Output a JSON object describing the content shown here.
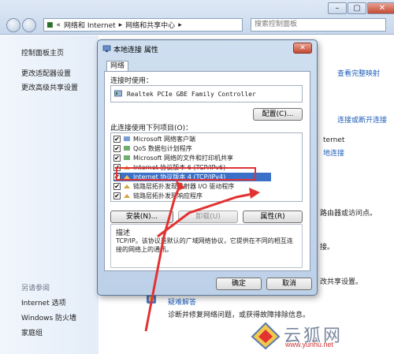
{
  "address_bar": {
    "path": [
      "«",
      "网络和 Internet",
      "▸",
      "网络和共享中心",
      "▸"
    ],
    "search_placeholder": "搜索控制面板"
  },
  "left_nav": {
    "items": [
      "控制面板主页",
      "更改适配器设置",
      "更改高级共享设置"
    ],
    "see_also_title": "另请参阅",
    "see_also_items": [
      "Internet 选项",
      "Windows 防火墙",
      "家庭组"
    ]
  },
  "right_content": {
    "view_full_map": "查看完整映射",
    "connect_disconnect": "连接或断开连接",
    "internet": "ternet",
    "local_connection": "地连接",
    "router_text": "路由器或访问点。",
    "connect_text": "接。",
    "sharing_text": "改共享设置。",
    "troubleshoot": "疑难解答",
    "troubleshoot_desc": "诊断并修复网络问题，或获得故障排除信息。"
  },
  "dialog": {
    "title": "本地连接 属性",
    "close_label": "✕",
    "tab_network": "网络",
    "connect_using_label": "连接时使用：",
    "adapter_name": "Realtek PCIe GBE Family Controller",
    "configure_button": "配置(C)...",
    "items_label": "此连接使用下列项目(O)：",
    "items": [
      {
        "label": "Microsoft 网络客户端",
        "checked": true
      },
      {
        "label": "QoS 数据包计划程序",
        "checked": true
      },
      {
        "label": "Microsoft 网络的文件和打印机共享",
        "checked": true
      },
      {
        "label": "Internet 协议版本 6 (TCP/IPv6)",
        "checked": true
      },
      {
        "label": "Internet 协议版本 4 (TCP/IPv4)",
        "checked": true
      },
      {
        "label": "链路层拓扑发现映射器 I/O 驱动程序",
        "checked": true
      },
      {
        "label": "链路层拓扑发现响应程序",
        "checked": true
      }
    ],
    "install_button": "安装(N)...",
    "uninstall_button": "卸载(U)",
    "properties_button": "属性(R)",
    "description_title": "描述",
    "description_text": "TCP/IP。该协议是默认的广域网络协议，它提供在不同的相互连接的网络上的通讯。",
    "ok_button": "确定",
    "cancel_button": "取消"
  },
  "watermark": {
    "text": "云狐网",
    "url": "www.yunhu.net"
  },
  "colors": {
    "selection": "#3a70c8",
    "highlight_box": "#e23232",
    "link": "#1f5fb8"
  }
}
